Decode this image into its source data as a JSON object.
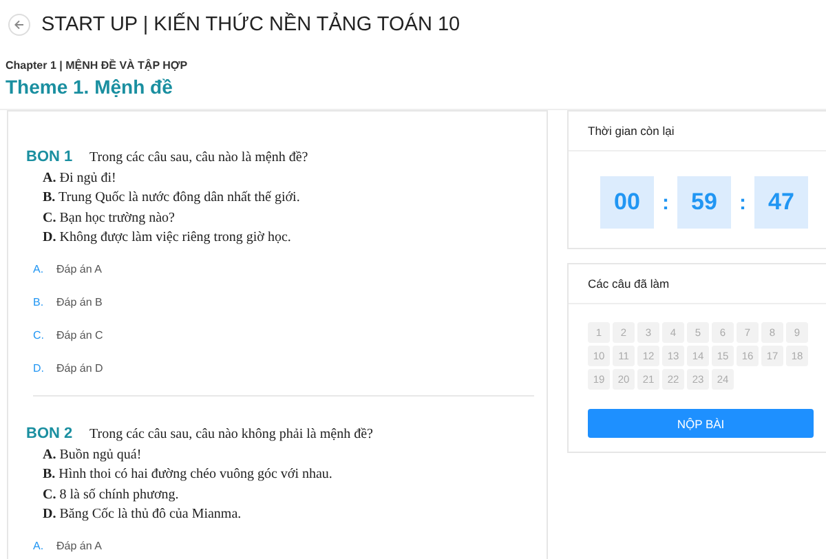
{
  "header": {
    "title": "START UP | KIẾN THỨC NỀN TẢNG TOÁN 10"
  },
  "chapter": "Chapter 1 | MỆNH ĐỀ VÀ TẬP HỢP",
  "theme": "Theme 1. Mệnh đề",
  "questions": [
    {
      "label": "BON 1",
      "prompt": "Trong các câu sau, câu nào là mệnh đề?",
      "statements": [
        {
          "letter": "A.",
          "text": "Đi ngủ đi!"
        },
        {
          "letter": "B.",
          "text": "Trung Quốc là nước đông dân nhất thế giới."
        },
        {
          "letter": "C.",
          "text": "Bạn học trường nào?"
        },
        {
          "letter": "D.",
          "text": "Không được làm việc riêng trong giờ học."
        }
      ],
      "answers": [
        {
          "letter": "A.",
          "text": "Đáp án A"
        },
        {
          "letter": "B.",
          "text": "Đáp án B"
        },
        {
          "letter": "C.",
          "text": "Đáp án C"
        },
        {
          "letter": "D.",
          "text": "Đáp án D"
        }
      ]
    },
    {
      "label": "BON 2",
      "prompt": "Trong các câu sau, câu nào không phải là mệnh đề?",
      "statements": [
        {
          "letter": "A.",
          "text": "Buồn ngủ quá!"
        },
        {
          "letter": "B.",
          "text": "Hình thoi có hai đường chéo vuông góc với nhau."
        },
        {
          "letter": "C.",
          "text": "8 là số chính phương."
        },
        {
          "letter": "D.",
          "text": "Băng Cốc là thủ đô của Mianma."
        }
      ],
      "answers": [
        {
          "letter": "A.",
          "text": "Đáp án A"
        }
      ]
    }
  ],
  "timer": {
    "title": "Thời gian còn lại",
    "hours": "00",
    "separator_1": ":",
    "minutes": "59",
    "separator_2": ":",
    "seconds": "47"
  },
  "progress": {
    "title": "Các câu đã làm",
    "numbers": [
      "1",
      "2",
      "3",
      "4",
      "5",
      "6",
      "7",
      "8",
      "9",
      "10",
      "11",
      "12",
      "13",
      "14",
      "15",
      "16",
      "17",
      "18",
      "19",
      "20",
      "21",
      "22",
      "23",
      "24"
    ],
    "submit": "NỘP BÀI"
  }
}
